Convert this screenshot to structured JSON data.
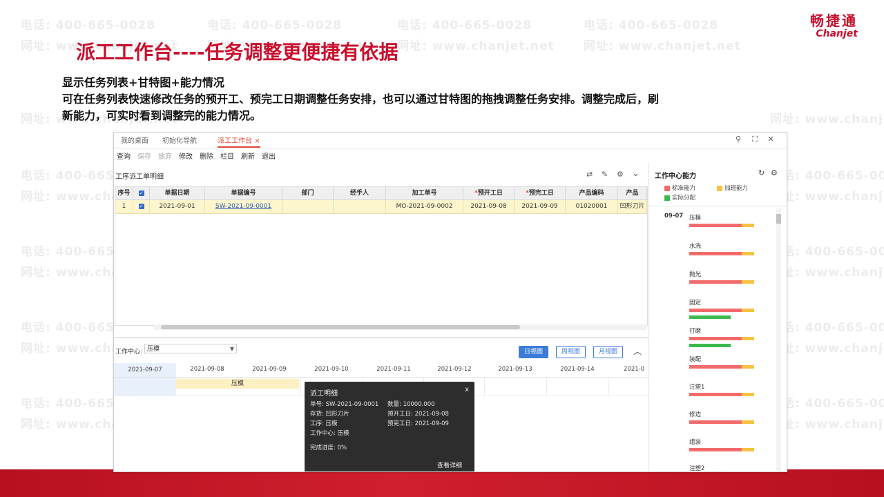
{
  "slide": {
    "title": "派工工作台----任务调整更便捷有依据",
    "desc_line1": "显示任务列表+甘特图+能力情况",
    "desc_line2": "可在任务列表快速修改任务的预开工、预完工日期调整任务安排，也可以通过甘特图的拖拽调整任务安排。调整完成后，刷",
    "desc_line3": "新能力，可实时看到调整完的能力情况。",
    "watermark_phone": "电话: 400-665-0028",
    "watermark_site": "网址: www.chanjet.net",
    "logo_cn": "畅捷通",
    "logo_en": "Chanjet",
    "brand_color": "#c8102e"
  },
  "app": {
    "tabs": [
      "我的桌面",
      "初始化导航",
      "派工工作台"
    ],
    "active_tab": "派工工作台",
    "window_controls": [
      "search-icon",
      "maximize-icon",
      "close-icon"
    ],
    "toolbar": {
      "query": "查询",
      "save": "保存",
      "abandon": "放弃",
      "modify": "修改",
      "delete": "删除",
      "columns": "栏目",
      "refresh": "刷新",
      "exit": "退出"
    },
    "list_panel_title": "工序派工单明细",
    "columns": [
      "序号",
      "",
      "单据日期",
      "单据编号",
      "部门",
      "经手人",
      "加工单号",
      "预开工日",
      "预完工日",
      "产品编码",
      "产品"
    ],
    "row": {
      "seq": "1",
      "date": "2021-09-01",
      "doc_no": "SW-2021-09-0001",
      "dept": "",
      "handler": "",
      "mo_no": "MO-2021-09-0002",
      "start": "2021-09-08",
      "finish": "2021-09-09",
      "product_code": "01020001",
      "product": "凹形刀片"
    },
    "work_center_label": "工作中心:",
    "work_center_value": "压模",
    "views": {
      "day": "日视图",
      "week": "周视图",
      "month": "月视图"
    },
    "gantt_dates": [
      "2021-09-07",
      "2021-09-08",
      "2021-09-09",
      "2021-09-10",
      "2021-09-11",
      "2021-09-12",
      "2021-09-13",
      "2021-09-14",
      "2021-0"
    ],
    "gantt_task": "压模",
    "popup": {
      "title": "派工明细",
      "close": "x",
      "doc_no": "单号: SW-2021-09-0001",
      "qty": "数量: 10000.000",
      "stock": "存货: 凹形刀片",
      "start": "预开工日: 2021-09-08",
      "process": "工序: 压模",
      "finish": "预完工日: 2021-09-09",
      "work_center": "工作中心: 压模",
      "progress": "完成进度: 0%",
      "detail_link": "查看详细"
    },
    "capacity": {
      "title": "工作中心能力",
      "legend": {
        "standard": "标准能力",
        "overtime": "加班能力",
        "actual": "实际分配"
      },
      "colors": {
        "standard": "#f26b6b",
        "overtime": "#f5c242",
        "actual": "#3dba4e"
      },
      "date": "09-07",
      "processes": [
        "压模",
        "水洗",
        "抛光",
        "固定",
        "打磨",
        "装配",
        "注塑1",
        "修边",
        "组装",
        "注塑2"
      ]
    }
  }
}
